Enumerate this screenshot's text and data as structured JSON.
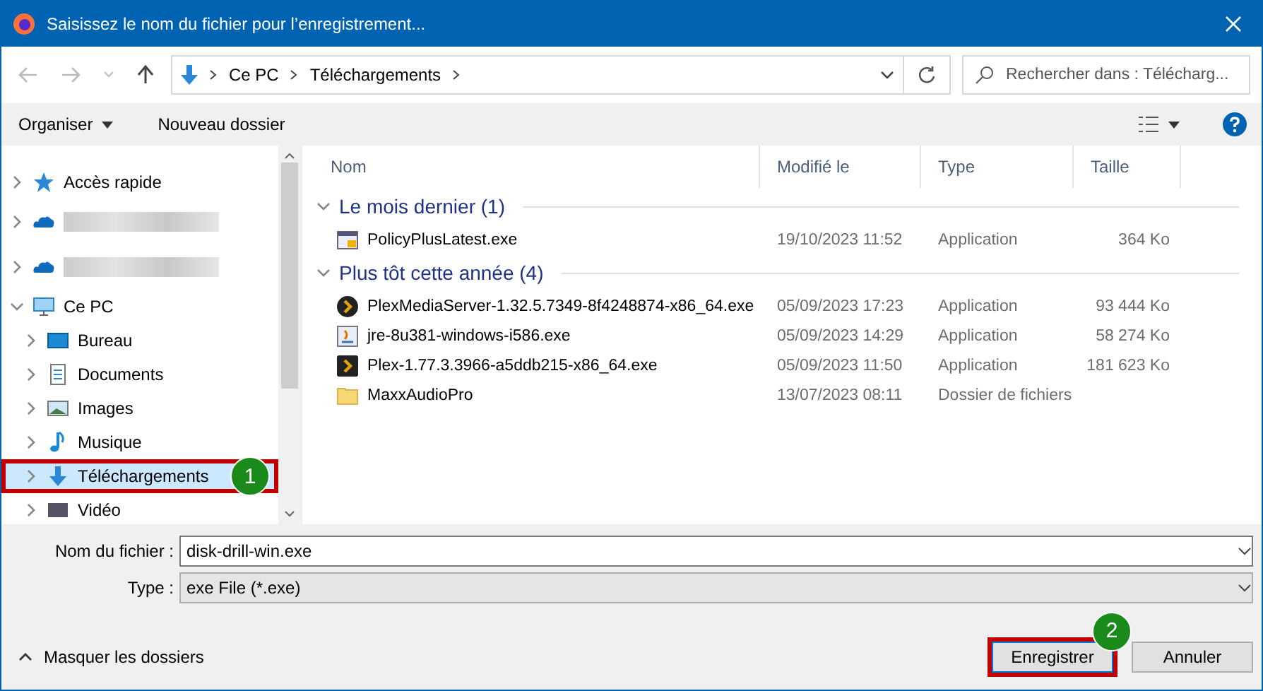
{
  "window": {
    "title": "Saisissez le nom du fichier pour l’enregistrement..."
  },
  "address": {
    "crumbs": [
      "Ce PC",
      "Téléchargements"
    ],
    "search_placeholder": "Rechercher dans : Télécharg..."
  },
  "toolbar": {
    "organize": "Organiser",
    "new_folder": "Nouveau dossier"
  },
  "sidebar": {
    "items": [
      {
        "kind": "quick",
        "label": "Accès rapide",
        "expanded": false,
        "selected": false
      },
      {
        "kind": "cloud",
        "expanded": false,
        "selected": false
      },
      {
        "kind": "cloud2",
        "expanded": false,
        "selected": false
      },
      {
        "kind": "pc",
        "label": "Ce PC",
        "expanded": true,
        "selected": false,
        "children": [
          {
            "kind": "desktop",
            "label": "Bureau",
            "expanded": false,
            "selected": false
          },
          {
            "kind": "doc",
            "label": "Documents",
            "expanded": false,
            "selected": false
          },
          {
            "kind": "image",
            "label": "Images",
            "expanded": false,
            "selected": false
          },
          {
            "kind": "music",
            "label": "Musique",
            "expanded": false,
            "selected": false
          },
          {
            "kind": "download",
            "label": "Téléchargements",
            "expanded": false,
            "selected": true,
            "annotation": "1"
          },
          {
            "kind": "video",
            "label": "Vidéo",
            "expanded": false,
            "selected": false
          }
        ]
      }
    ]
  },
  "table": {
    "columns": [
      "Nom",
      "Modifié le",
      "Type",
      "Taille"
    ],
    "groups": [
      {
        "title": "Le mois dernier (1)",
        "expanded": true,
        "rows": [
          {
            "kind": "policy",
            "name": "PolicyPlusLatest.exe",
            "date": "19/10/2023 11:52",
            "type": "Application",
            "size": "364 Ko"
          }
        ]
      },
      {
        "title": "Plus tôt cette année (4)",
        "expanded": true,
        "rows": [
          {
            "kind": "plex-round",
            "name": "PlexMediaServer-1.32.5.7349-8f4248874-x86_64.exe",
            "date": "05/09/2023 17:23",
            "type": "Application",
            "size": "93 444 Ko"
          },
          {
            "kind": "java",
            "name": "jre-8u381-windows-i586.exe",
            "date": "05/09/2023 14:29",
            "type": "Application",
            "size": "58 274 Ko"
          },
          {
            "kind": "plex-square",
            "name": "Plex-1.77.3.3966-a5ddb215-x86_64.exe",
            "date": "05/09/2023 11:50",
            "type": "Application",
            "size": "181 623 Ko"
          },
          {
            "kind": "folder",
            "name": "MaxxAudioPro",
            "date": "13/07/2023 08:11",
            "type": "Dossier de fichiers",
            "size": ""
          }
        ]
      }
    ]
  },
  "form": {
    "filename_label": "Nom du fichier :",
    "filename": "disk-drill-win.exe",
    "type_label": "Type :",
    "type": "exe File (*.exe)"
  },
  "footer": {
    "hide_folders": "Masquer les dossiers",
    "save": "Enregistrer",
    "save_annotation": "2",
    "cancel": "Annuler"
  }
}
